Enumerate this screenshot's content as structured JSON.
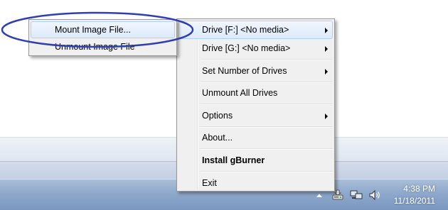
{
  "main_menu": {
    "items": [
      {
        "label": "Drive [F:] <No media>",
        "submenu": true
      },
      {
        "label": "Drive [G:] <No media>",
        "submenu": true
      },
      {
        "label": "Set Number of Drives",
        "submenu": true
      },
      {
        "label": "Unmount All Drives"
      },
      {
        "label": "Options",
        "submenu": true
      },
      {
        "label": "About..."
      },
      {
        "label": "Install gBurner"
      },
      {
        "label": "Exit"
      }
    ]
  },
  "sub_menu": {
    "items": [
      {
        "label": "Mount Image File..."
      },
      {
        "label": "Unmount Image File"
      }
    ]
  },
  "taskbar": {
    "clock_time": "4:38 PM",
    "clock_date": "11/18/2011",
    "tray_icons": [
      "show-hidden-icons-arrow-icon",
      "gburner-drive-icon",
      "network-icon",
      "volume-icon"
    ]
  },
  "colors": {
    "annotation": "#2f3fb0",
    "menu_bg": "#f0f0f0",
    "hover_border": "#aecff7"
  }
}
